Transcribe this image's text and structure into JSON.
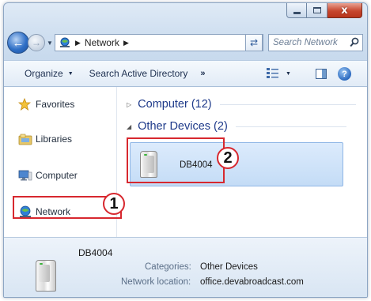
{
  "window": {
    "caption": {
      "minimize": "—",
      "maximize": "□",
      "close": "x"
    }
  },
  "address_bar": {
    "breadcrumbs": [
      "Network"
    ],
    "search_placeholder": "Search Network"
  },
  "command_bar": {
    "items": [
      {
        "label": "Organize",
        "dropdown": true
      },
      {
        "label": "Search Active Directory",
        "dropdown": false
      }
    ],
    "more": "»",
    "help": "?"
  },
  "nav_pane": {
    "items": [
      {
        "label": "Favorites",
        "icon": "star-icon"
      },
      {
        "label": "Libraries",
        "icon": "libraries-icon"
      },
      {
        "label": "Computer",
        "icon": "computer-icon"
      },
      {
        "label": "Network",
        "icon": "network-icon",
        "selected": true
      }
    ]
  },
  "file_pane": {
    "groups": [
      {
        "label": "Computer (12)",
        "expanded": false
      },
      {
        "label": "Other Devices (2)",
        "expanded": true
      }
    ],
    "items": [
      {
        "label": "DB4004",
        "icon": "device-icon",
        "selected": true
      }
    ]
  },
  "details_pane": {
    "name": "DB4004",
    "categories_label": "Categories:",
    "categories_value": "Other Devices",
    "location_label": "Network location:",
    "location_value": "office.devabroadcast.com"
  },
  "callouts": [
    "1",
    "2"
  ],
  "colors": {
    "callout": "#d7282f",
    "selection": "#c4dcf6",
    "group_header": "#1e3a8a"
  }
}
